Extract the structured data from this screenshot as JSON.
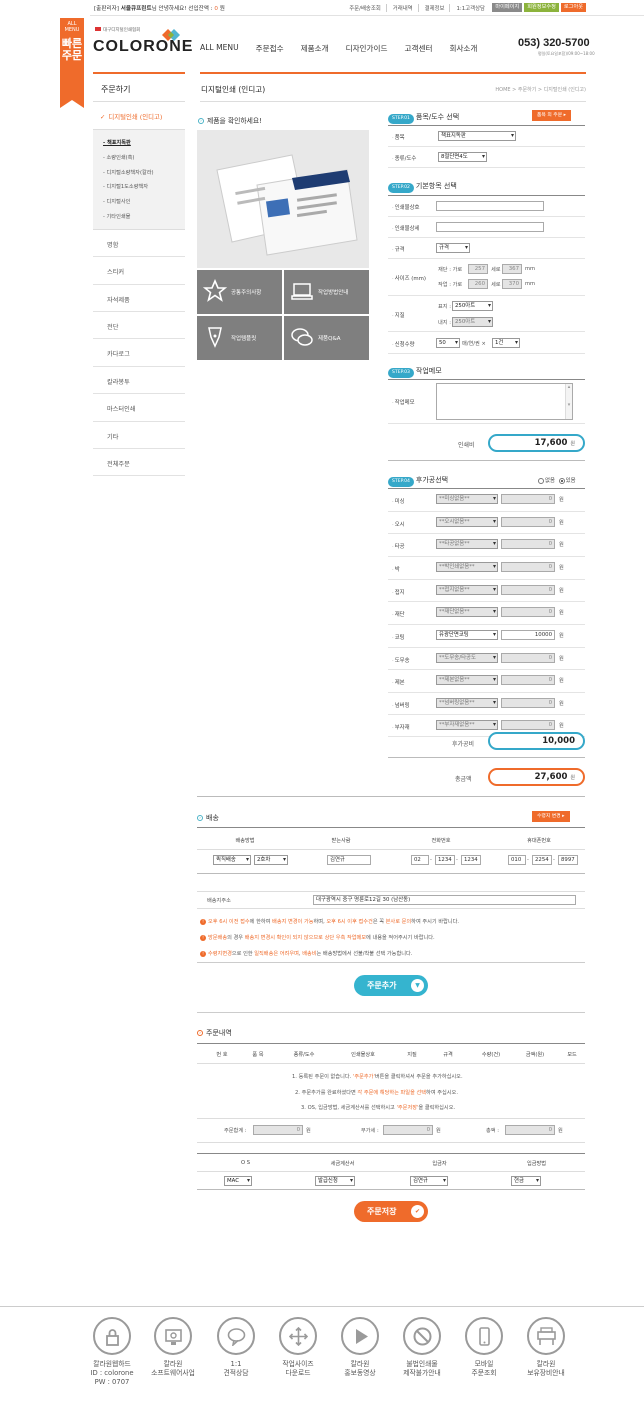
{
  "top": {
    "greet_pre": "[출판리자]",
    "greet_name": "서울큐프린트",
    "greet_mid": "님 안녕하세요! 선입잔액 :",
    "greet_balance": "0",
    "greet_unit": "원",
    "links": [
      "주문/배송조회",
      "거래내역",
      "결제정보",
      "1:1고객상담"
    ],
    "btn_mypage": "마이페이지",
    "btn_member": "회원정보수정",
    "btn_logout": "로그아웃"
  },
  "ribbon": {
    "small": "ALL MENU",
    "big": "빠른주문"
  },
  "logo": {
    "sub": "대구디지털인쇄협회",
    "name": "COLORONE"
  },
  "gnb": [
    "ALL MENU",
    "주문접수",
    "제품소개",
    "디자인가이드",
    "고객센터",
    "회사소개"
  ],
  "phone": "053) 320-5700",
  "phone_sub": "평일(토요일포함)/09:00~18:00",
  "lnb": {
    "title": "주문하기",
    "active": "디지털인쇄 (인디고)",
    "sub": [
      "책표지독판",
      "소량인쇄(흑)",
      "디지털소량책자(칼라)",
      "디지털1도소량책자",
      "디지털사인",
      "기타인쇄물"
    ],
    "items": [
      "명함",
      "스티커",
      "자석제품",
      "전단",
      "카다로그",
      "칼라봉투",
      "마스터인쇄",
      "기타",
      "전체주문"
    ]
  },
  "page": {
    "title": "디지털인쇄 (인디고)",
    "breadcrumb": "HOME > 주문하기 > 디지털인쇄 (인디고)",
    "check": "제품을 확인하세요!"
  },
  "tiles": [
    "공통주의사항",
    "작업방법안내",
    "작업템플릿",
    "제품Q&A"
  ],
  "step1": {
    "badge": "STEP.01",
    "title": "품목/도수 선택",
    "btn": "품목 외 주문",
    "item_label": "품목",
    "item_value": "책표지독판",
    "type_label": "종류/도수",
    "type_value": "8절단면4도"
  },
  "step2": {
    "badge": "STEP.02",
    "title": "기본항목 선택",
    "name_label": "인쇄물상호",
    "detail_label": "인쇄물상세",
    "spec_label": "규격",
    "spec_value": "규격",
    "size_label": "사이즈 (mm)",
    "cut": "재단 : 가로",
    "cut_w": "257",
    "cut_h": "367",
    "work": "작업 : 가로",
    "work_w": "260",
    "work_h": "370",
    "h_label": "세로",
    "mm": "mm",
    "paper_label": "지질",
    "cover": "표지 :",
    "cover_value": "250아트",
    "inner": "내지 :",
    "inner_value": "250아트",
    "qty_label": "신청수량",
    "qty": "50",
    "qty_unit": "매/연/권 ×",
    "qty_count": "1건"
  },
  "step3": {
    "badge": "STEP.03",
    "title": "작업메모",
    "memo_label": "작업메모",
    "price_label": "인쇄비",
    "price": "17,600",
    "won": "원"
  },
  "step4": {
    "badge": "STEP.04",
    "title": "후가공선택",
    "no": "없음",
    "yes": "있음",
    "rows": [
      {
        "label": "미싱",
        "sel": "**미싱없음**",
        "val": "0",
        "dis": true
      },
      {
        "label": "오시",
        "sel": "**오시없음**",
        "val": "0",
        "dis": true
      },
      {
        "label": "타공",
        "sel": "**타공없음**",
        "val": "0",
        "dis": true
      },
      {
        "label": "박",
        "sel": "**박인쇄없음**",
        "val": "0",
        "dis": true
      },
      {
        "label": "접지",
        "sel": "**접지없음**",
        "val": "0",
        "dis": true
      },
      {
        "label": "재단",
        "sel": "**재단없음**",
        "val": "0",
        "dis": true
      },
      {
        "label": "코팅",
        "sel": "유광단면코팅",
        "val": "10000",
        "dis": false
      },
      {
        "label": "도무송",
        "sel": "**도무송/타공도",
        "val": "0",
        "dis": true
      },
      {
        "label": "제본",
        "sel": "**제본없음**",
        "val": "0",
        "dis": true
      },
      {
        "label": "넘버링",
        "sel": "**넘버링없음**",
        "val": "0",
        "dis": true
      },
      {
        "label": "부자재",
        "sel": "**부자재없음**",
        "val": "0",
        "dis": true
      }
    ],
    "post_label": "후가공비",
    "post": "10,000",
    "total_label": "총금액",
    "total": "27,600"
  },
  "delivery": {
    "title": "배송",
    "btn": "수령지 변경",
    "cols": [
      "배송방법",
      "받는사람",
      "전화번호",
      "휴대폰번호"
    ],
    "method": "퀵직배송",
    "method2": "2호차",
    "receiver": "김연규",
    "tel": [
      "02",
      "1234",
      "1234"
    ],
    "mobile": [
      "010",
      "2254",
      "8997"
    ],
    "addr_label": "배송지주소",
    "addr": "대구광역시 중구 명륜로12길 30 (남산동)",
    "notes": [
      {
        "a": "오후 6시 이전 접수",
        "b": "에 한하여 ",
        "c": "배송지 변경이 가능",
        "d": "하며, ",
        "e": "오후 6시 이후 접수건",
        "f": "은 꼭 ",
        "g": "본사로 문의",
        "h": "하여 주시기 바랍니다."
      },
      {
        "a": "방문배송",
        "b": "의 경우 ",
        "c": "배송지 변경시 확인이 되지 않으므로",
        "d": " ",
        "e": "상단 우측 작업메모",
        "f": "에 내용을 적어주시기 바랍니다.",
        "g": "",
        "h": ""
      },
      {
        "a": "수령지변경",
        "b": "으로 인한 ",
        "c": "일직배송은 어려우며",
        "d": ", ",
        "e": "배송비",
        "f": "는 배송방법에서 선불/착불 선택 가능합니다.",
        "g": "",
        "h": ""
      }
    ],
    "add_btn": "주문추가"
  },
  "orders": {
    "title": "주문내역",
    "cols": [
      "번 호",
      "품 목",
      "종류/도수",
      "인쇄물상호",
      "지질",
      "규격",
      "수량(건)",
      "금액(원)",
      "모드"
    ],
    "msg1a": "1. 등록된 주문이 없습니다. ",
    "msg1b": "'주문추가'",
    "msg1c": "버튼을 클릭하셔서 주문을 추가하십시오.",
    "msg2a": "2. 주문추가를 완료하셨다면 ",
    "msg2b": "각 주문에 해당하는 파일을 선택",
    "msg2c": "하여 주십시오.",
    "msg3a": "3. OS, 입금방법, 세금계산서를 선택하시고 ",
    "msg3b": "'주문저장'",
    "msg3c": "을 클릭하십시오.",
    "sum_label": "주문합계 :",
    "sum": "0",
    "vat_label": "부가세 :",
    "vat": "0",
    "total_label": "총액 :",
    "total": "0",
    "won": "원"
  },
  "pay": {
    "cols": [
      "O S",
      "세금계산서",
      "입금자",
      "입금방법"
    ],
    "os": "MAC",
    "tax": "발급신청",
    "payer": "김연규",
    "method": "현금",
    "save_btn": "주문저장"
  },
  "footer": [
    {
      "icon": "lock-icon",
      "label": "칼라원웹하드\nID : colorone\nPW : 0707"
    },
    {
      "icon": "monitor-gear-icon",
      "label": "칼라원\n소프트웨어사업"
    },
    {
      "icon": "speech-bubble-icon",
      "label": "1:1\n견적상담"
    },
    {
      "icon": "move-arrows-icon",
      "label": "작업사이즈\n다운로드"
    },
    {
      "icon": "play-icon",
      "label": "칼라원\n홍보동영상"
    },
    {
      "icon": "prohibited-icon",
      "label": "불법인쇄물\n제작불가안내"
    },
    {
      "icon": "mobile-icon",
      "label": "모바일\n주문조회"
    },
    {
      "icon": "plotter-icon",
      "label": "칼라원\n보유장비안내"
    }
  ]
}
